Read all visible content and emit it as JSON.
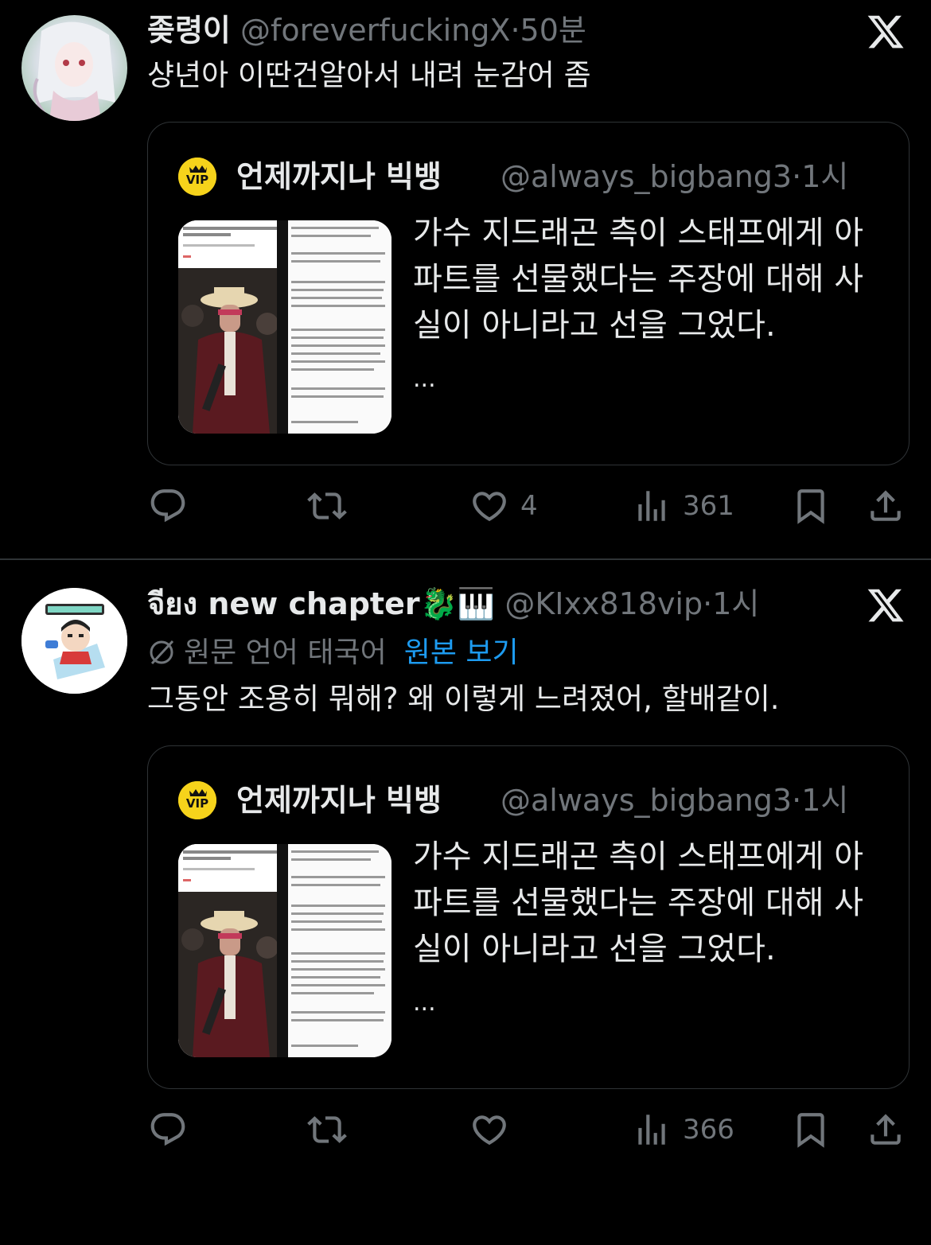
{
  "tweets": [
    {
      "display_name": "좆령이",
      "handle": "@foreverfuckingX",
      "separator": "·",
      "time": "50분",
      "text": "샹년아 이딴건알아서 내려 눈감어 좀",
      "quote": {
        "display_name": "언제까지나 빅뱅",
        "handle": "@always_bigbang3",
        "separator": "·",
        "time": "1시",
        "text_lines": [
          "가수 지드래곤 측이 스태프에게 아",
          "파트를 선물했다는 주장에 대해 사",
          "실이 아니라고 선을 그었다."
        ],
        "ellipsis": "...",
        "logo_text": "VIP"
      },
      "actions": {
        "reply": "",
        "retweet": "",
        "like": "4",
        "views": "361"
      }
    },
    {
      "display_name": "จียง new chapter🐉🎹",
      "handle": "@KIxx818vip",
      "separator": "·",
      "time": "1시",
      "translation_label": "원문 언어 태국어",
      "translation_link": "원본 보기",
      "text": "그동안 조용히 뭐해? 왜 이렇게 느려졌어, 할배같이.",
      "quote": {
        "display_name": "언제까지나 빅뱅",
        "handle": "@always_bigbang3",
        "separator": "·",
        "time": "1시",
        "text_lines": [
          "가수 지드래곤 측이 스태프에게 아",
          "파트를 선물했다는 주장에 대해 사",
          "실이 아니라고 선을 그었다."
        ],
        "ellipsis": "...",
        "logo_text": "VIP"
      },
      "actions": {
        "reply": "",
        "retweet": "",
        "like": "",
        "views": "366"
      }
    }
  ],
  "icons": [
    "globe-slash-icon",
    "x-logo-icon",
    "reply-icon",
    "retweet-icon",
    "like-icon",
    "views-icon",
    "bookmark-icon",
    "share-icon"
  ],
  "colors": {
    "background": "#000000",
    "text": "#e7e9ea",
    "muted": "#71767b",
    "link": "#1d9bf0",
    "border": "#2f3336"
  }
}
